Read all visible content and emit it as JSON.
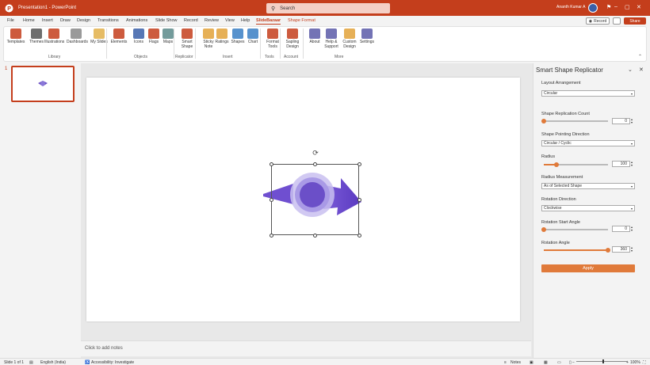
{
  "titlebar": {
    "doc_title": "Presentation1 - PowerPoint",
    "search_placeholder": "Search",
    "user_name": "Ananth Kumar A",
    "app_icon": "powerpoint-icon"
  },
  "menu": {
    "tabs": [
      "File",
      "Home",
      "Insert",
      "Draw",
      "Design",
      "Transitions",
      "Animations",
      "Slide Show",
      "Record",
      "Review",
      "View",
      "Help",
      "SlideBazaar",
      "Shape Format"
    ],
    "active": "SlideBazaar",
    "record_label": "Record",
    "share_label": "Share"
  },
  "ribbon": {
    "buttons": [
      {
        "label": "Templates",
        "icon": "templates-icon",
        "color": "#c43e1c"
      },
      {
        "label": "Themes",
        "icon": "themes-icon",
        "color": "#555555"
      },
      {
        "label": "Illustrations",
        "icon": "illustrations-icon",
        "color": "#c43e1c"
      },
      {
        "label": "Dashboards",
        "icon": "dashboards-icon",
        "color": "#888888"
      },
      {
        "label": "My Slides",
        "icon": "my-slides-icon",
        "color": "#e2b04a"
      },
      {
        "label": "Elements",
        "icon": "elements-icon",
        "color": "#c43e1c"
      },
      {
        "label": "Icons",
        "icon": "icons-icon",
        "color": "#3a5fa8"
      },
      {
        "label": "Flags",
        "icon": "flags-icon",
        "color": "#c43e1c"
      },
      {
        "label": "Maps",
        "icon": "maps-icon",
        "color": "#5a8a8a"
      },
      {
        "label": "Smart Shape",
        "icon": "smart-shape-icon",
        "color": "#c43e1c"
      },
      {
        "label": "Sticky Note",
        "icon": "sticky-note-icon",
        "color": "#e2a23a"
      },
      {
        "label": "Ratings",
        "icon": "ratings-icon",
        "color": "#e2a23a"
      },
      {
        "label": "Shapes",
        "icon": "shapes-icon",
        "color": "#3a7fc4"
      },
      {
        "label": "Chart",
        "icon": "chart-icon",
        "color": "#3a7fc4"
      },
      {
        "label": "Format Tools",
        "icon": "format-tools-icon",
        "color": "#c43e1c"
      },
      {
        "label": "Sapling Design",
        "icon": "sapling-design-icon",
        "color": "#c43e1c"
      },
      {
        "label": "About",
        "icon": "about-icon",
        "color": "#5a5aa8"
      },
      {
        "label": "Help & Support",
        "icon": "help-icon",
        "color": "#5a5aa8"
      },
      {
        "label": "Custom Design",
        "icon": "custom-design-icon",
        "color": "#e2a23a"
      },
      {
        "label": "Settings",
        "icon": "settings-icon",
        "color": "#5a5aa8"
      }
    ],
    "groups": [
      "Library",
      "Objects",
      "Replicator",
      "Insert",
      "Tools",
      "Account",
      "More"
    ]
  },
  "thumbnails": {
    "number": "1"
  },
  "notes": {
    "placeholder": "Click to add notes"
  },
  "panel": {
    "title": "Smart Shape Replicator",
    "layout_label": "Layout Arrangement",
    "layout_value": "Circular",
    "count_label": "Shape Replication Count",
    "count_value": "0",
    "count_fraction": 0.0,
    "direction_label": "Shape Pointing Direction",
    "direction_value": "Circular / Cyclic",
    "radius_label": "Radius",
    "radius_value": "100",
    "radius_fraction": 0.2,
    "measure_label": "Radius Measurement",
    "measure_value": "As of Selected Shape",
    "rotation_dir_label": "Rotation Direction",
    "rotation_dir_value": "Clockwise",
    "start_angle_label": "Rotation Start Angle",
    "start_angle_value": "0",
    "start_angle_fraction": 0.0,
    "angle_label": "Rotation Angle",
    "angle_value": "360",
    "angle_fraction": 1.0,
    "apply_label": "Apply",
    "accent": "#e07a3a"
  },
  "statusbar": {
    "slide_info": "Slide 1 of 1",
    "language": "English (India)",
    "accessibility": "Accessibility: Investigate",
    "notes_label": "Notes",
    "zoom": "100%"
  }
}
